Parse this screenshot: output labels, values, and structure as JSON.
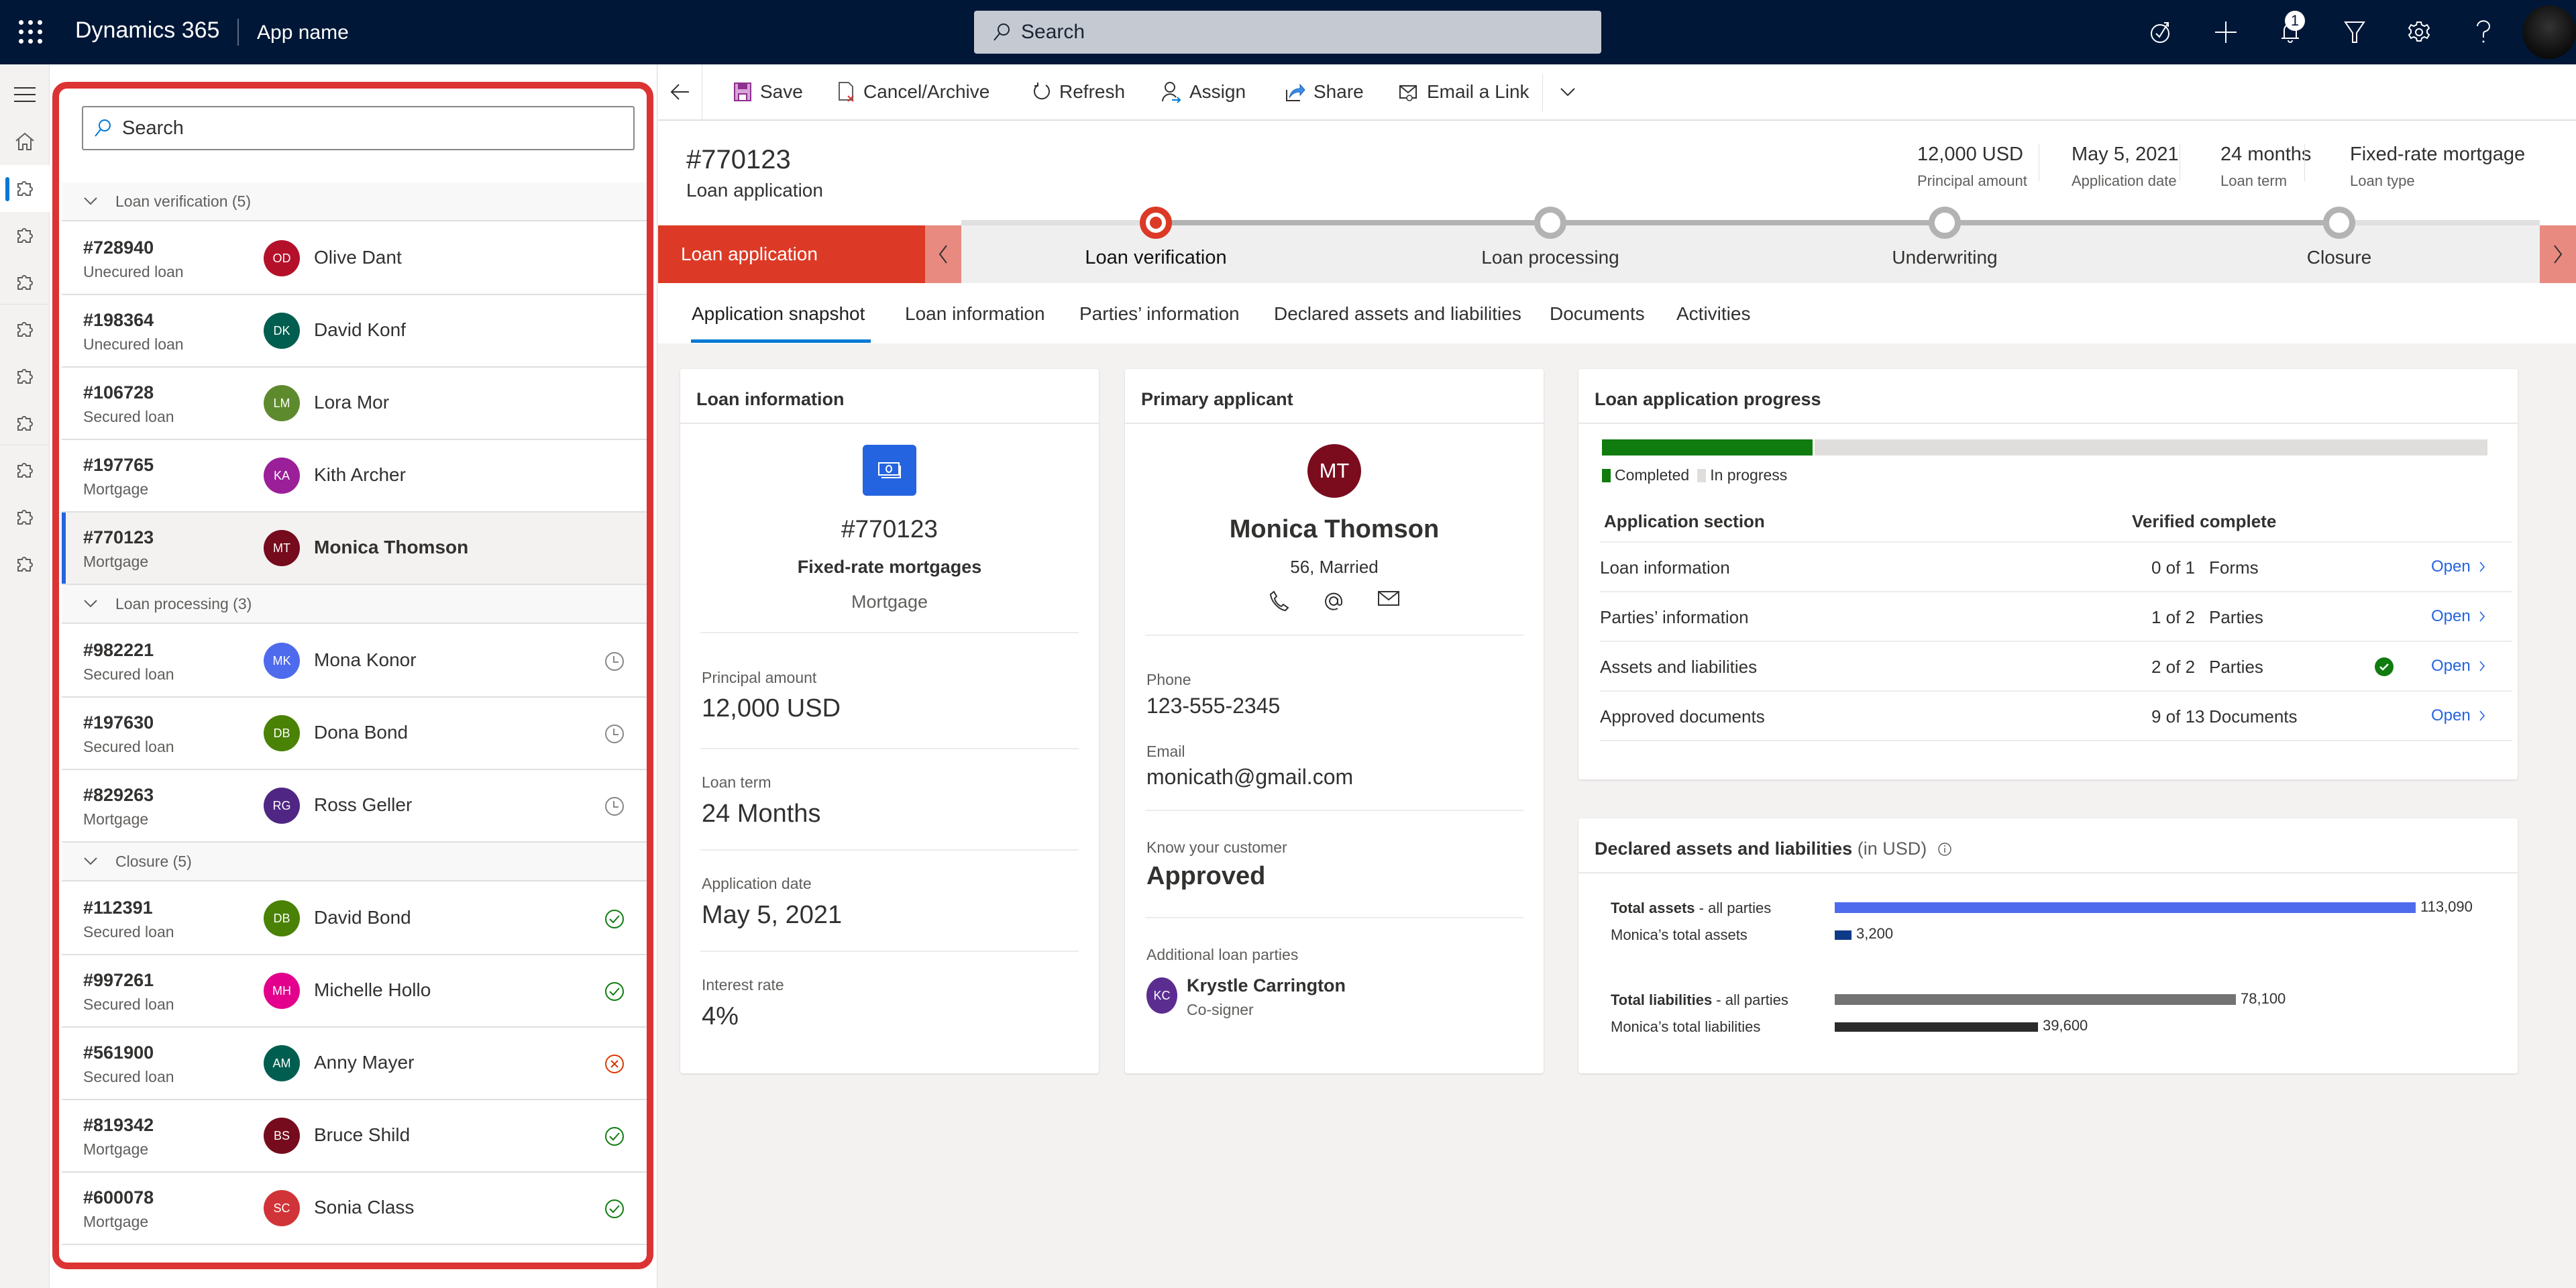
{
  "topbar": {
    "brand": "Dynamics 365",
    "app_name": "App name",
    "search_placeholder": "Search",
    "notification_count": "1",
    "icons": [
      "task-flow-icon",
      "add-icon",
      "bell-icon",
      "filter-icon",
      "settings-icon",
      "help-icon",
      "user-avatar"
    ]
  },
  "rail": {
    "items": [
      "menu-icon",
      "home-icon",
      "puzzle-icon",
      "puzzle-icon",
      "puzzle-icon",
      "puzzle-icon",
      "puzzle-icon",
      "puzzle-icon",
      "puzzle-icon",
      "puzzle-icon",
      "puzzle-icon"
    ],
    "active_index": 2
  },
  "list": {
    "search_placeholder": "Search",
    "groups": [
      {
        "label": "Loan verification (5)",
        "rows": [
          {
            "num": "#728940",
            "type": "Unecured loan",
            "initials": "OD",
            "name": "Olive Dant",
            "color": "#b4102a",
            "status": ""
          },
          {
            "num": "#198364",
            "type": "Unecured loan",
            "initials": "DK",
            "name": "David Konf",
            "color": "#005e50",
            "status": ""
          },
          {
            "num": "#106728",
            "type": "Secured loan",
            "initials": "LM",
            "name": "Lora Mor",
            "color": "#5e8a2e",
            "status": ""
          },
          {
            "num": "#197765",
            "type": "Mortgage",
            "initials": "KA",
            "name": "Kith Archer",
            "color": "#9b1f99",
            "status": ""
          },
          {
            "num": "#770123",
            "type": "Mortgage",
            "initials": "MT",
            "name": "Monica Thomson",
            "color": "#750b1c",
            "status": "",
            "selected": true
          }
        ]
      },
      {
        "label": "Loan processing (3)",
        "rows": [
          {
            "num": "#982221",
            "type": "Secured loan",
            "initials": "MK",
            "name": "Mona Konor",
            "color": "#4f6bed",
            "status": "pending"
          },
          {
            "num": "#197630",
            "type": "Secured loan",
            "initials": "DB",
            "name": "Dona Bond",
            "color": "#498205",
            "status": "pending"
          },
          {
            "num": "#829263",
            "type": "Mortgage",
            "initials": "RG",
            "name": "Ross Geller",
            "color": "#4f2683",
            "status": "pending"
          }
        ]
      },
      {
        "label": "Closure (5)",
        "rows": [
          {
            "num": "#112391",
            "type": "Secured loan",
            "initials": "DB",
            "name": "David Bond",
            "color": "#498205",
            "status": "approved"
          },
          {
            "num": "#997261",
            "type": "Secured loan",
            "initials": "MH",
            "name": "Michelle Hollo",
            "color": "#e3008c",
            "status": "approved"
          },
          {
            "num": "#561900",
            "type": "Secured loan",
            "initials": "AM",
            "name": "Anny Mayer",
            "color": "#005e50",
            "status": "rejected"
          },
          {
            "num": "#819342",
            "type": "Mortgage",
            "initials": "BS",
            "name": "Bruce Shild",
            "color": "#750b1c",
            "status": "approved"
          },
          {
            "num": "#600078",
            "type": "Mortgage",
            "initials": "SC",
            "name": "Sonia Class",
            "color": "#d13438",
            "status": "approved"
          }
        ]
      }
    ]
  },
  "commandbar": {
    "save": "Save",
    "cancel_archive": "Cancel/Archive",
    "refresh": "Refresh",
    "assign": "Assign",
    "share": "Share",
    "email_link": "Email a Link"
  },
  "record": {
    "title": "#770123",
    "subtitle": "Loan application",
    "header_fields": [
      {
        "value": "12,000 USD",
        "label": "Principal amount"
      },
      {
        "value": "May 5, 2021",
        "label": "Application date"
      },
      {
        "value": "24 months",
        "label": "Loan term"
      },
      {
        "value": "Fixed-rate mortgage",
        "label": "Loan type"
      }
    ]
  },
  "stages": {
    "process_name": "Loan application",
    "items": [
      "Loan verification",
      "Loan processing",
      "Underwriting",
      "Closure"
    ],
    "current_index": 0
  },
  "tabs": {
    "items": [
      "Application snapshot",
      "Loan information",
      "Parties’ information",
      "Declared assets and liabilities",
      "Documents",
      "Activities"
    ],
    "active_index": 0
  },
  "loan_card": {
    "title": "Loan information",
    "number": "#770123",
    "product": "Fixed-rate mortgages",
    "category": "Mortgage",
    "fields": [
      {
        "label": "Principal amount",
        "value": "12,000 USD"
      },
      {
        "label": "Loan term",
        "value": "24 Months"
      },
      {
        "label": "Application date",
        "value": "May 5, 2021"
      },
      {
        "label": "Interest rate",
        "value": "4%"
      }
    ]
  },
  "applicant_card": {
    "title": "Primary applicant",
    "initials": "MT",
    "name": "Monica Thomson",
    "details": "56, Married",
    "phone_label": "Phone",
    "phone": "123-555-2345",
    "email_label": "Email",
    "email": "monicath@gmail.com",
    "kyc_label": "Know your customer",
    "kyc_value": "Approved",
    "parties_label": "Additional loan parties",
    "party": {
      "initials": "KC",
      "name": "Krystle Carrington",
      "role": "Co-signer"
    }
  },
  "progress_card": {
    "title": "Loan application progress",
    "completed_fraction": 0.24,
    "legend_completed": "Completed",
    "legend_in_progress": "In progress",
    "col_section": "Application section",
    "col_verified": "Verified complete",
    "rows": [
      {
        "section": "Loan information",
        "count": "0 of 1",
        "unit": "Forms",
        "complete": false,
        "action": "Open"
      },
      {
        "section": "Parties’ information",
        "count": "1 of 2",
        "unit": "Parties",
        "complete": false,
        "action": "Open"
      },
      {
        "section": "Assets and liabilities",
        "count": "2 of 2",
        "unit": "Parties",
        "complete": true,
        "action": "Open"
      },
      {
        "section": "Approved documents",
        "count": "9 of 13",
        "unit": "Documents",
        "complete": false,
        "action": "Open"
      }
    ]
  },
  "assets_card": {
    "title": "Declared assets and liabilities",
    "title_suffix": "(in USD)"
  },
  "chart_data": {
    "type": "bar",
    "orientation": "horizontal",
    "title": "Declared assets and liabilities (in USD)",
    "categories": [
      "Total assets - all parties",
      "Monica's total assets",
      "Total liabilities - all parties",
      "Monica's total liabilities"
    ],
    "rows": [
      {
        "bold": "Total assets",
        "rest": " - all parties",
        "value": 113090,
        "label": "113,090",
        "color": "#4f6bed"
      },
      {
        "bold": "",
        "rest": "Monica’s total  assets",
        "value": 3200,
        "label": "3,200",
        "color": "#0e3a8a"
      },
      {
        "bold": "Total liabilities",
        "rest": " - all parties",
        "value": 78100,
        "label": "78,100",
        "color": "#737373"
      },
      {
        "bold": "",
        "rest": "Monica’s total  liabilities",
        "value": 39600,
        "label": "39,600",
        "color": "#2b2b2b"
      }
    ],
    "values": [
      113090,
      3200,
      78100,
      39600
    ],
    "xlim": [
      0,
      113090
    ],
    "grid": false
  }
}
